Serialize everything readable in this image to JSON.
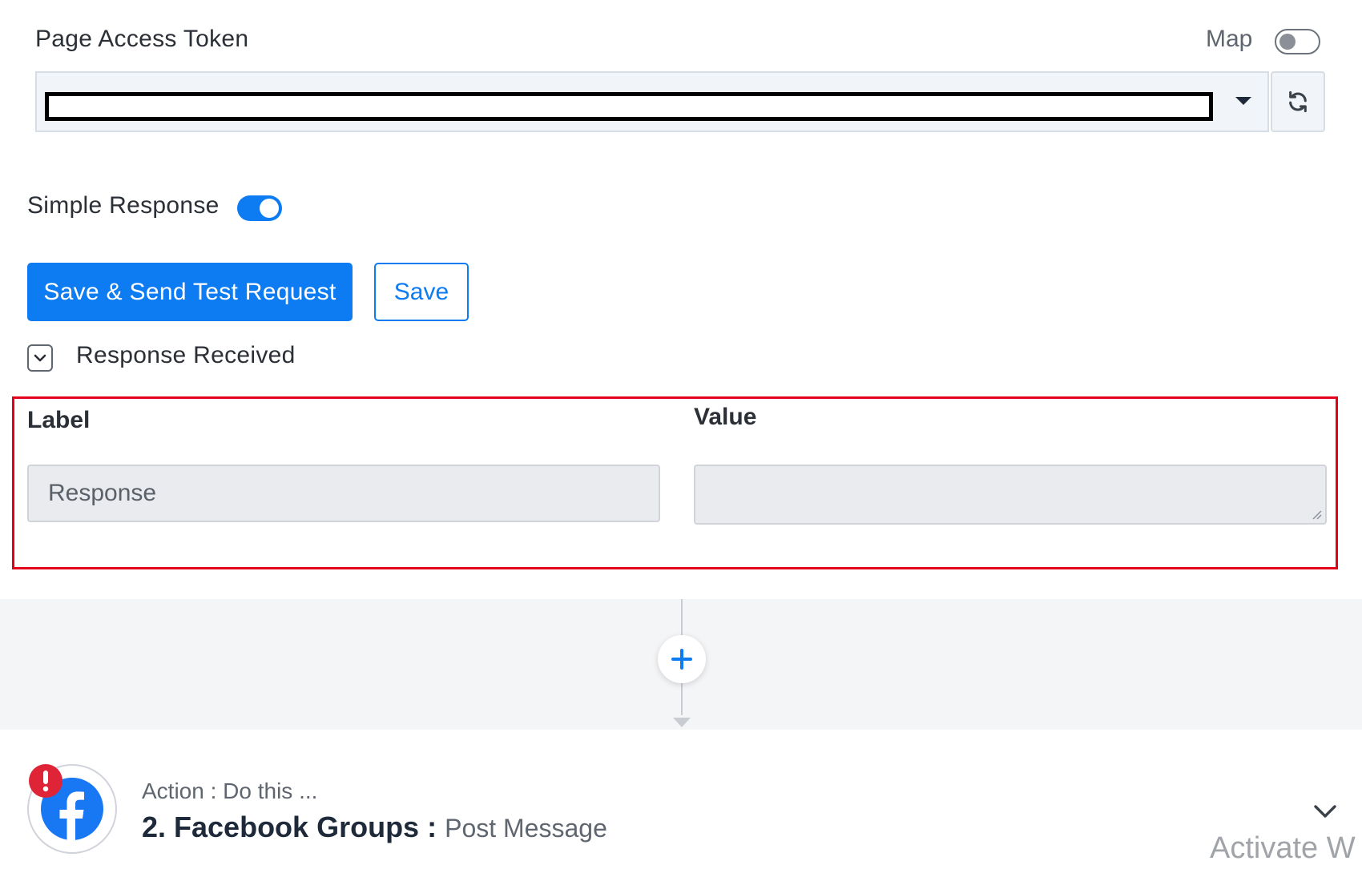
{
  "page_token": {
    "label": "Page Access Token",
    "map_label": "Map",
    "map_enabled": false,
    "selected_value": ""
  },
  "simple_response": {
    "label": "Simple Response",
    "enabled": true
  },
  "buttons": {
    "save_test": "Save & Send Test Request",
    "save": "Save"
  },
  "response": {
    "section_label": "Response Received",
    "label_header": "Label",
    "value_header": "Value",
    "rows": [
      {
        "label": "Response",
        "value": ""
      }
    ]
  },
  "action": {
    "subtitle": "Action : Do this ...",
    "app": "2. Facebook Groups :",
    "event": "Post Message",
    "status": "error"
  },
  "watermark": "Activate W",
  "colors": {
    "primary": "#0d7bf2",
    "highlight_frame": "#e3001b",
    "alert": "#e02437",
    "facebook": "#1877f2"
  },
  "icons": {
    "refresh": "refresh-icon",
    "dropdown": "caret-down-icon",
    "collapse": "chevron-down-icon",
    "add": "plus-icon",
    "app": "facebook-icon",
    "alert": "exclamation-icon"
  }
}
